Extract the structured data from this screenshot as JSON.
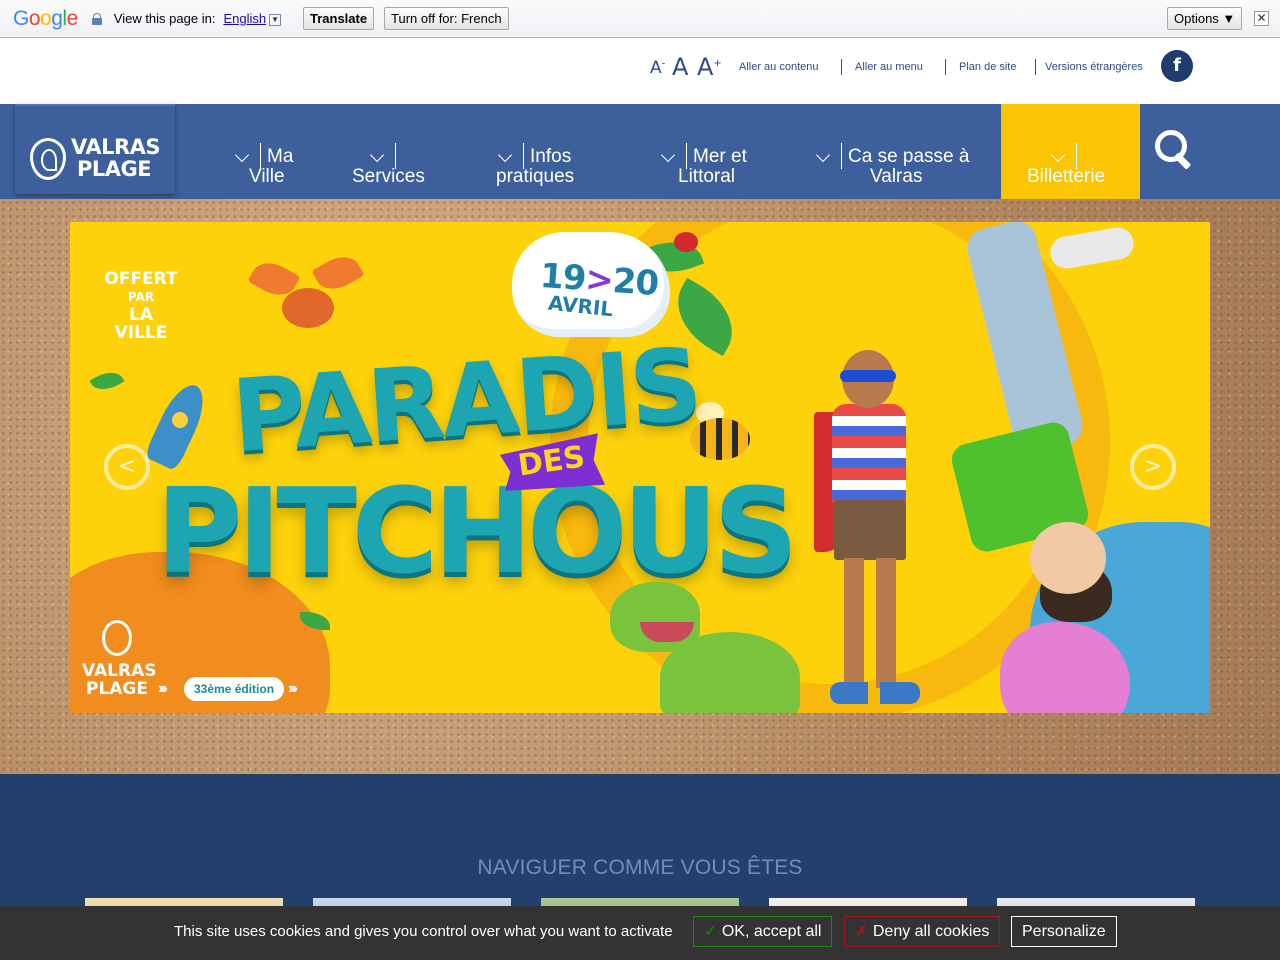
{
  "translate_bar": {
    "logo": [
      "G",
      "o",
      "o",
      "g",
      "l",
      "e"
    ],
    "view_text": "View this page in:",
    "language": "English",
    "translate_label": "Translate",
    "turn_off_label": "Turn off for: French",
    "options_label": "Options ▼",
    "close_symbol": "✕"
  },
  "accessibility": {
    "font_small": "A",
    "font_small_sup": "-",
    "font_normal": "A",
    "font_large": "A",
    "font_large_sup": "+",
    "links": [
      "Aller au contenu",
      "Aller au menu",
      "Plan de site",
      "Versions étrangères"
    ],
    "facebook_glyph": "f"
  },
  "logo": {
    "line1": "VALRAS",
    "line2": "PLAGE"
  },
  "nav": {
    "items": [
      {
        "line1": "Ma",
        "line2": "Ville"
      },
      {
        "line1": "",
        "line2": "Services"
      },
      {
        "line1": "Infos",
        "line2": "pratiques"
      },
      {
        "line1": "Mer et",
        "line2": "Littoral"
      },
      {
        "line1": "Ca se passe à",
        "line2": "Valras"
      },
      {
        "line1": "",
        "line2": "Billetterie"
      }
    ],
    "highlight_color": "#fbc503",
    "bar_color": "#3d5f9c"
  },
  "slide": {
    "date": "19",
    "date_sep": ">",
    "date_end": "20",
    "month": "AVRIL",
    "offert": [
      "OFFERT",
      "PAR",
      "LA VILLE"
    ],
    "title_top": "PARADIS",
    "title_mid": "DES",
    "title_bottom": "PITCHOUS",
    "logo_line1": "VALRAS",
    "logo_line2": "PLAGE",
    "edition": "33ème édition",
    "prev": "<",
    "next": ">"
  },
  "navigator": {
    "title": "NAVIGUER COMME VOUS ÊTES"
  },
  "cookie": {
    "text": "This site uses cookies and gives you control over what you want to activate",
    "ok_mark": "✓",
    "ok_label": "OK, accept all",
    "deny_mark": "✗",
    "deny_label": "Deny all cookies",
    "personalize_label": "Personalize"
  }
}
